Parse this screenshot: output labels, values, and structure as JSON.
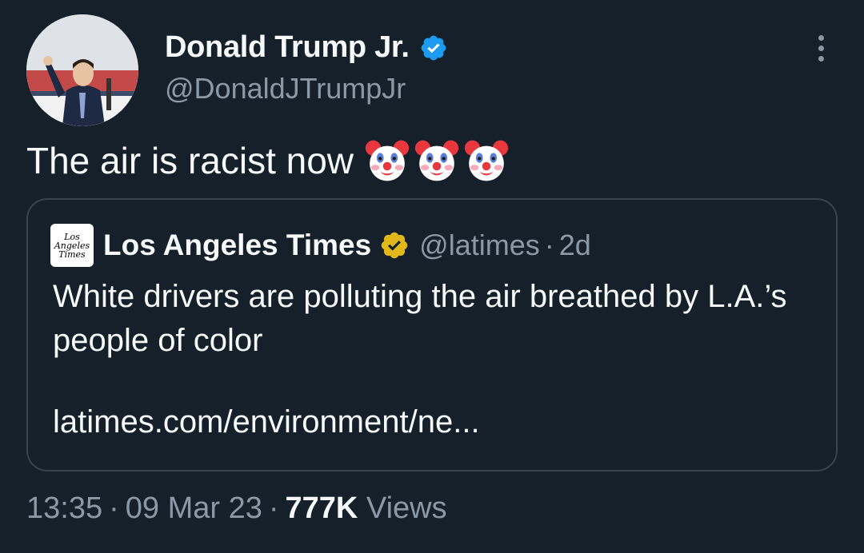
{
  "author": {
    "display_name": "Donald Trump Jr.",
    "handle": "@DonaldJTrumpJr",
    "verified_color": "#1d9bf0"
  },
  "tweet": {
    "text": "The air is racist now",
    "emojis": [
      "clown-face-icon",
      "clown-face-icon",
      "clown-face-icon"
    ]
  },
  "quote": {
    "logo_lines": [
      "Los",
      "Angeles",
      "Times"
    ],
    "display_name": "Los Angeles Times",
    "badge_color": "#e2b719",
    "handle": "@latimes",
    "separator": "·",
    "time": "2d",
    "text": "White drivers are polluting the air breathed by L.A.’s people of color",
    "link": "latimes.com/environment/ne..."
  },
  "meta": {
    "time": "13:35",
    "date": "09 Mar 23",
    "separator": "·",
    "views_count": "777K",
    "views_label": "Views"
  },
  "colors": {
    "background": "#15202b",
    "primary_text": "#f7f9f9",
    "secondary_text": "#8b98a5",
    "border": "#38444d"
  }
}
